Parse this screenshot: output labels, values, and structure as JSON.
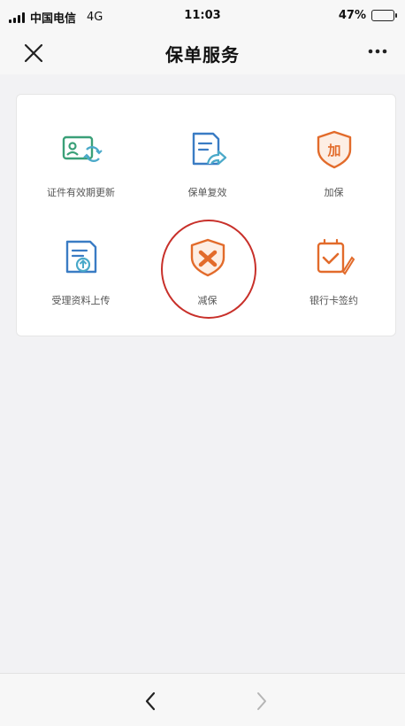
{
  "status_bar": {
    "carrier": "中国电信",
    "network": "4G",
    "time": "11:03",
    "battery": "47%",
    "battery_level": 0.47,
    "battery_color": "#f0c419"
  },
  "nav_bar": {
    "title": "保单服务",
    "close_icon": "close-icon",
    "more_icon": "more-icon"
  },
  "services": [
    {
      "label": "证件有效期更新",
      "icon": "id-card-refresh-icon",
      "color": "#3aa078"
    },
    {
      "label": "保单复效",
      "icon": "document-forward-icon",
      "color": "#3a7cc4"
    },
    {
      "label": "加保",
      "icon": "shield-plus-icon",
      "color": "#e26b2b",
      "icon_text": "加"
    },
    {
      "label": "受理资料上传",
      "icon": "document-upload-icon",
      "color": "#3a7cc4"
    },
    {
      "label": "减保",
      "icon": "shield-minus-icon",
      "color": "#e26b2b"
    },
    {
      "label": "银行卡签约",
      "icon": "card-sign-icon",
      "color": "#e26b2b"
    }
  ],
  "annotation": {
    "highlighted_item": "减保",
    "circle_color": "#c8302a"
  },
  "bottom_bar": {
    "back_icon": "back-arrow-icon",
    "forward_icon": "forward-arrow-icon"
  }
}
